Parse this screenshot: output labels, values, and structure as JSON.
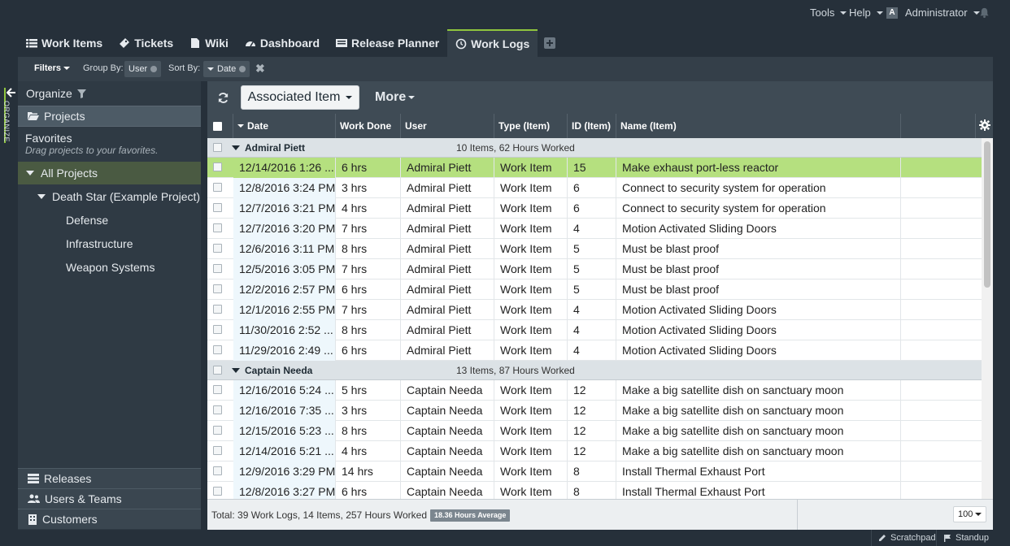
{
  "topbar": {
    "tools": "Tools",
    "help": "Help",
    "avatar_letter": "A",
    "user": "Administrator"
  },
  "tabs": [
    {
      "label": "Work Items",
      "icon": "list-icon"
    },
    {
      "label": "Tickets",
      "icon": "ticket-icon"
    },
    {
      "label": "Wiki",
      "icon": "document-icon"
    },
    {
      "label": "Dashboard",
      "icon": "gauge-icon"
    },
    {
      "label": "Release Planner",
      "icon": "planner-icon"
    },
    {
      "label": "Work Logs",
      "icon": "clock-icon",
      "active": true
    }
  ],
  "filterbar": {
    "filters": "Filters",
    "group_by_label": "Group By:",
    "group_by_value": "User",
    "sort_by_label": "Sort By:",
    "sort_by_value": "Date"
  },
  "strip": {
    "label": "ORGANIZE"
  },
  "sidebar": {
    "organize": "Organize",
    "projects": "Projects",
    "favorites": "Favorites",
    "favorites_hint": "Drag projects to your favorites.",
    "all_projects": "All Projects",
    "project": "Death Star (Example Project)",
    "children": [
      "Defense",
      "Infrastructure",
      "Weapon Systems"
    ],
    "bottom": [
      "Releases",
      "Users & Teams",
      "Customers"
    ]
  },
  "toolbar": {
    "associated_item": "Associated Item",
    "more": "More"
  },
  "columns": [
    "Date",
    "Work Done",
    "User",
    "Type (Item)",
    "ID (Item)",
    "Name (Item)"
  ],
  "groups": [
    {
      "name": "Admiral Piett",
      "summary": "10 Items, 62 Hours Worked",
      "rows": [
        [
          "12/14/2016 1:26 ...",
          "6 hrs",
          "Admiral Piett",
          "Work Item",
          "15",
          "Make exhaust port-less reactor"
        ],
        [
          "12/8/2016 3:24 PM",
          "3 hrs",
          "Admiral Piett",
          "Work Item",
          "6",
          "Connect to security system for operation"
        ],
        [
          "12/7/2016 3:21 PM",
          "4 hrs",
          "Admiral Piett",
          "Work Item",
          "6",
          "Connect to security system for operation"
        ],
        [
          "12/7/2016 3:20 PM",
          "7 hrs",
          "Admiral Piett",
          "Work Item",
          "4",
          "Motion Activated Sliding Doors"
        ],
        [
          "12/6/2016 3:11 PM",
          "8 hrs",
          "Admiral Piett",
          "Work Item",
          "5",
          "Must be blast proof"
        ],
        [
          "12/5/2016 3:05 PM",
          "7 hrs",
          "Admiral Piett",
          "Work Item",
          "5",
          "Must be blast proof"
        ],
        [
          "12/2/2016 2:57 PM",
          "6 hrs",
          "Admiral Piett",
          "Work Item",
          "5",
          "Must be blast proof"
        ],
        [
          "12/1/2016 2:55 PM",
          "7 hrs",
          "Admiral Piett",
          "Work Item",
          "4",
          "Motion Activated Sliding Doors"
        ],
        [
          "11/30/2016 2:52 ...",
          "8 hrs",
          "Admiral Piett",
          "Work Item",
          "4",
          "Motion Activated Sliding Doors"
        ],
        [
          "11/29/2016 2:49 ...",
          "6 hrs",
          "Admiral Piett",
          "Work Item",
          "4",
          "Motion Activated Sliding Doors"
        ]
      ]
    },
    {
      "name": "Captain Needa",
      "summary": "13 Items, 87 Hours Worked",
      "rows": [
        [
          "12/16/2016 5:24 ...",
          "5 hrs",
          "Captain Needa",
          "Work Item",
          "12",
          "Make a big satellite dish on sanctuary moon"
        ],
        [
          "12/16/2016 7:35 ...",
          "3 hrs",
          "Captain Needa",
          "Work Item",
          "12",
          "Make a big satellite dish on sanctuary moon"
        ],
        [
          "12/15/2016 5:23 ...",
          "8 hrs",
          "Captain Needa",
          "Work Item",
          "12",
          "Make a big satellite dish on sanctuary moon"
        ],
        [
          "12/14/2016 5:21 ...",
          "4 hrs",
          "Captain Needa",
          "Work Item",
          "12",
          "Make a big satellite dish on sanctuary moon"
        ],
        [
          "12/9/2016 3:29 PM",
          "14 hrs",
          "Captain Needa",
          "Work Item",
          "8",
          "Install Thermal Exhaust Port"
        ],
        [
          "12/8/2016 3:27 PM",
          "6 hrs",
          "Captain Needa",
          "Work Item",
          "8",
          "Install Thermal Exhaust Port"
        ]
      ]
    }
  ],
  "footer": {
    "total": "Total: 39 Work Logs, 14 Items, 257 Hours Worked",
    "average": "18.36 Hours Average",
    "page_size": "100"
  },
  "bottombar": {
    "scratchpad": "Scratchpad",
    "standup": "Standup"
  },
  "colors": {
    "accent": "#8fc53e",
    "selected_row": "#b5e07f",
    "header_bg": "#3f4b55",
    "app_bg": "#26303a"
  }
}
